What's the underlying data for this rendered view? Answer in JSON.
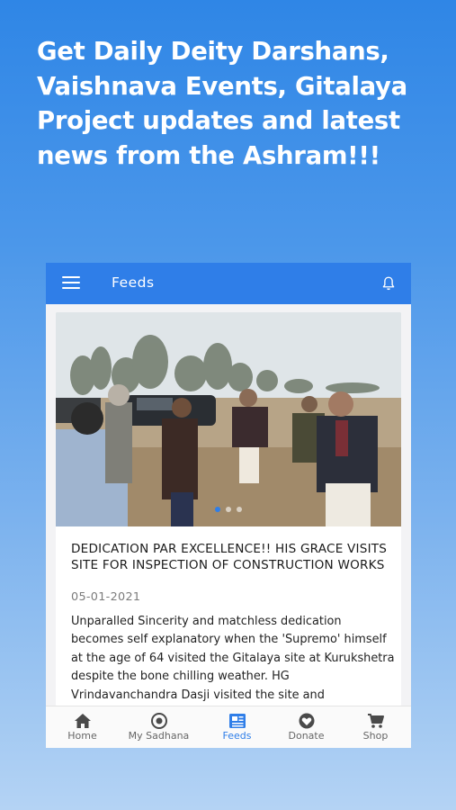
{
  "promo": {
    "text": "Get Daily Deity Darshans, Vaishnava Events, Gitalaya Project updates and latest news from the Ashram!!!"
  },
  "appbar": {
    "title": "Feeds",
    "menu_icon": "hamburger-menu-icon",
    "notification_icon": "bell-icon"
  },
  "feed": {
    "post": {
      "title": "DEDICATION PAR EXCELLENCE!! HIS GRACE VISITS SITE FOR INSPECTION OF CONSTRUCTION WORKS",
      "date": "05-01-2021",
      "excerpt": "Unparalled Sincerity and matchless dedication becomes self explanatory when the 'Supremo' himself at the age of 64 visited the Gitalaya site at Kurukshetra despite the bone chilling weather. HG Vrindavanchandra Dasji visited the site and",
      "carousel_active_index": 0,
      "carousel_count": 3
    }
  },
  "bottom_nav": {
    "items": [
      {
        "label": "Home",
        "icon": "home-icon",
        "active": false
      },
      {
        "label": "My Sadhana",
        "icon": "target-icon",
        "active": false
      },
      {
        "label": "Feeds",
        "icon": "newspaper-icon",
        "active": true
      },
      {
        "label": "Donate",
        "icon": "heart-icon",
        "active": false
      },
      {
        "label": "Shop",
        "icon": "cart-icon",
        "active": false
      }
    ]
  },
  "colors": {
    "primary": "#2f7ee8",
    "nav_inactive": "#666666"
  }
}
